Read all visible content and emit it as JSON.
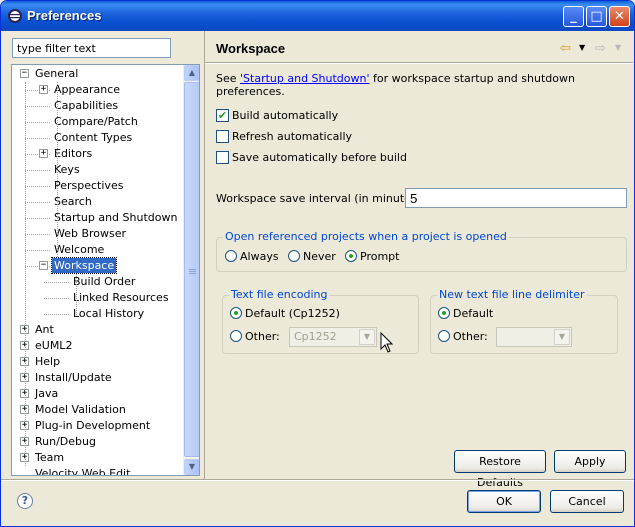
{
  "window": {
    "title": "Preferences"
  },
  "filter": {
    "placeholder": "type filter text"
  },
  "tree": {
    "items": [
      {
        "label": "General",
        "level": 0,
        "expander": "-",
        "selected": false
      },
      {
        "label": "Appearance",
        "level": 1,
        "expander": "+",
        "selected": false
      },
      {
        "label": "Capabilities",
        "level": 1,
        "expander": "",
        "selected": false
      },
      {
        "label": "Compare/Patch",
        "level": 1,
        "expander": "",
        "selected": false
      },
      {
        "label": "Content Types",
        "level": 1,
        "expander": "",
        "selected": false
      },
      {
        "label": "Editors",
        "level": 1,
        "expander": "+",
        "selected": false
      },
      {
        "label": "Keys",
        "level": 1,
        "expander": "",
        "selected": false
      },
      {
        "label": "Perspectives",
        "level": 1,
        "expander": "",
        "selected": false
      },
      {
        "label": "Search",
        "level": 1,
        "expander": "",
        "selected": false
      },
      {
        "label": "Startup and Shutdown",
        "level": 1,
        "expander": "",
        "selected": false
      },
      {
        "label": "Web Browser",
        "level": 1,
        "expander": "",
        "selected": false
      },
      {
        "label": "Welcome",
        "level": 1,
        "expander": "",
        "selected": false
      },
      {
        "label": "Workspace",
        "level": 1,
        "expander": "-",
        "selected": true
      },
      {
        "label": "Build Order",
        "level": 2,
        "expander": "",
        "selected": false
      },
      {
        "label": "Linked Resources",
        "level": 2,
        "expander": "",
        "selected": false
      },
      {
        "label": "Local History",
        "level": 2,
        "expander": "",
        "selected": false
      },
      {
        "label": "Ant",
        "level": 0,
        "expander": "+",
        "selected": false
      },
      {
        "label": "eUML2",
        "level": 0,
        "expander": "+",
        "selected": false
      },
      {
        "label": "Help",
        "level": 0,
        "expander": "+",
        "selected": false
      },
      {
        "label": "Install/Update",
        "level": 0,
        "expander": "+",
        "selected": false
      },
      {
        "label": "Java",
        "level": 0,
        "expander": "+",
        "selected": false
      },
      {
        "label": "Model Validation",
        "level": 0,
        "expander": "+",
        "selected": false
      },
      {
        "label": "Plug-in Development",
        "level": 0,
        "expander": "+",
        "selected": false
      },
      {
        "label": "Run/Debug",
        "level": 0,
        "expander": "+",
        "selected": false
      },
      {
        "label": "Team",
        "level": 0,
        "expander": "+",
        "selected": false
      },
      {
        "label": "Velocity Web Edit",
        "level": 0,
        "expander": "",
        "selected": false
      }
    ]
  },
  "page": {
    "title": "Workspace",
    "see_prefix": "See ",
    "see_link": "'Startup and Shutdown'",
    "see_suffix": " for workspace startup and shutdown preferences.",
    "checkboxes": [
      {
        "label": "Build automatically",
        "checked": true
      },
      {
        "label": "Refresh automatically",
        "checked": false
      },
      {
        "label": "Save automatically before build",
        "checked": false
      }
    ],
    "save_interval_label": "Workspace save interval (in minutes):",
    "save_interval_value": "5",
    "open_projects": {
      "title": "Open referenced projects when a project is opened",
      "options": [
        "Always",
        "Never",
        "Prompt"
      ],
      "selected": "Prompt"
    },
    "encoding": {
      "title": "Text file encoding",
      "default_label": "Default (Cp1252)",
      "other_label": "Other:",
      "other_value": "Cp1252",
      "selected": "default"
    },
    "delimiter": {
      "title": "New text file line delimiter",
      "default_label": "Default",
      "other_label": "Other:",
      "other_value": "",
      "selected": "default"
    },
    "restore_defaults_label": "Restore Defaults",
    "apply_label": "Apply"
  },
  "footer": {
    "ok_label": "OK",
    "cancel_label": "Cancel"
  },
  "colors": {
    "accent": "#316ac5",
    "titlebar": "#0a50d0",
    "group_title": "#0046d5"
  }
}
